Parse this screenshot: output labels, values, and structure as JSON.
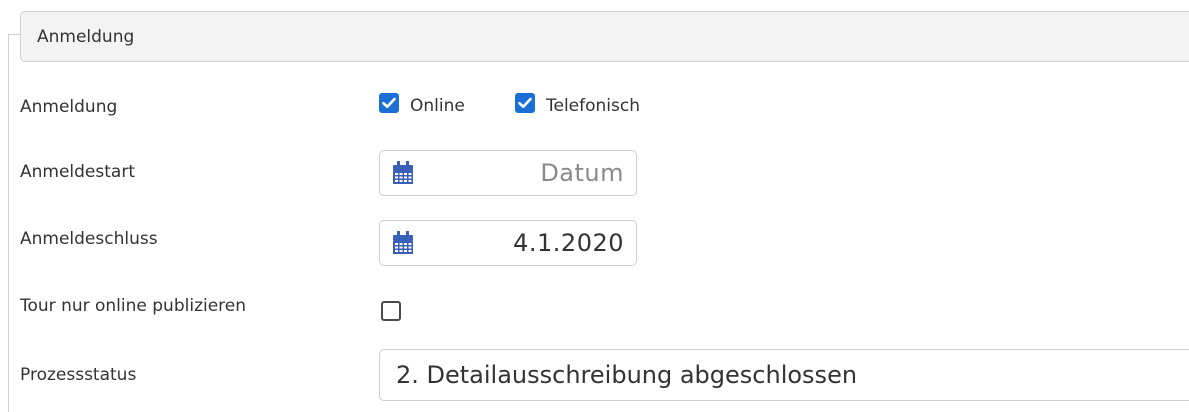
{
  "section": {
    "legend": "Anmeldung"
  },
  "fields": {
    "anmeldung": {
      "label": "Anmeldung",
      "options": [
        {
          "label": "Online",
          "checked": true
        },
        {
          "label": "Telefonisch",
          "checked": true
        }
      ]
    },
    "anmeldestart": {
      "label": "Anmeldestart",
      "value": "",
      "placeholder": "Datum"
    },
    "anmeldeschluss": {
      "label": "Anmeldeschluss",
      "value": "4.1.2020"
    },
    "nur_online": {
      "label": "Tour nur online publizieren",
      "checked": false
    },
    "prozessstatus": {
      "label": "Prozessstatus",
      "value": "2. Detailausschreibung abgeschlossen"
    }
  },
  "colors": {
    "checkbox_checked": "#1a6fd6",
    "calendar_icon": "#3a5fb8"
  },
  "icons": [
    "calendar-icon",
    "checkmark-icon"
  ]
}
